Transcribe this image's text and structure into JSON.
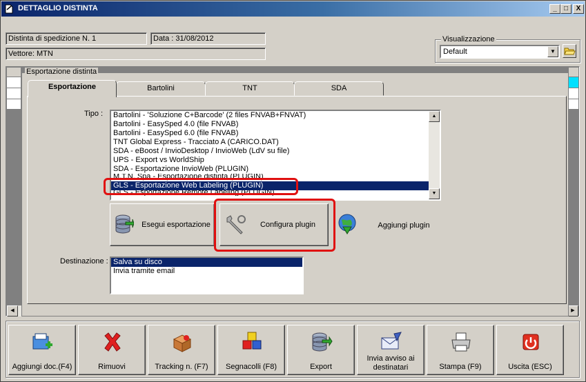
{
  "window": {
    "title": "DETTAGLIO DISTINTA",
    "controls": [
      "_",
      "□",
      "X"
    ]
  },
  "header": {
    "distinta": "Distinta di spedizione N. 1",
    "data": "Data : 31/08/2012",
    "vettore": "Vettore: MTN"
  },
  "visualizzazione": {
    "label": "Visualizzazione",
    "selected": "Default"
  },
  "export_group": {
    "label": "Esportazione distinta"
  },
  "tabs": [
    {
      "label": "Esportazione",
      "active": true
    },
    {
      "label": "Bartolini",
      "active": false
    },
    {
      "label": "TNT",
      "active": false
    },
    {
      "label": "SDA",
      "active": false
    }
  ],
  "tipo": {
    "label": "Tipo :",
    "items": [
      "Bartolini - 'Soluzione C+Barcode' (2 files FNVAB+FNVAT)",
      "Bartolini - EasySped 4.0 (file FNVAB)",
      "Bartolini - EasySped 6.0 (file FNVAB)",
      "TNT Global Express - Tracciato A (CARICO.DAT)",
      "SDA - eBoost / InvioDesktop / InvioWeb (LdV su file)",
      "UPS - Export vs WorldShip",
      "SDA - Esportazione InvioWeb (PLUGIN)",
      "M.T.N. Spa - Esportazione distinta (PLUGIN)",
      "GLS - Esportazione Web Labeling (PLUGIN)",
      "GLS - Esportazione Remote Labeling (PLUGIN)"
    ],
    "selected_index": 8
  },
  "actions": {
    "esegui": "Esegui esportazione",
    "configura": "Configura plugin",
    "aggiungi": "Aggiungi plugin"
  },
  "destinazione": {
    "label": "Destinazione :",
    "items": [
      "Salva su disco",
      "Invia tramite email"
    ],
    "selected_index": 0
  },
  "toolbar": {
    "aggiungi_doc": "Aggiungi doc.(F4)",
    "rimuovi": "Rimuovi",
    "tracking": "Tracking n. (F7)",
    "segnacolli": "Segnacolli (F8)",
    "export": "Export",
    "invia_avviso": "Invia avviso ai destinatari",
    "stampa": "Stampa (F9)",
    "uscita": "Uscita (ESC)"
  },
  "colors": {
    "selection": "#0a246a",
    "highlight": "#e01010",
    "face": "#d4d0c8"
  }
}
